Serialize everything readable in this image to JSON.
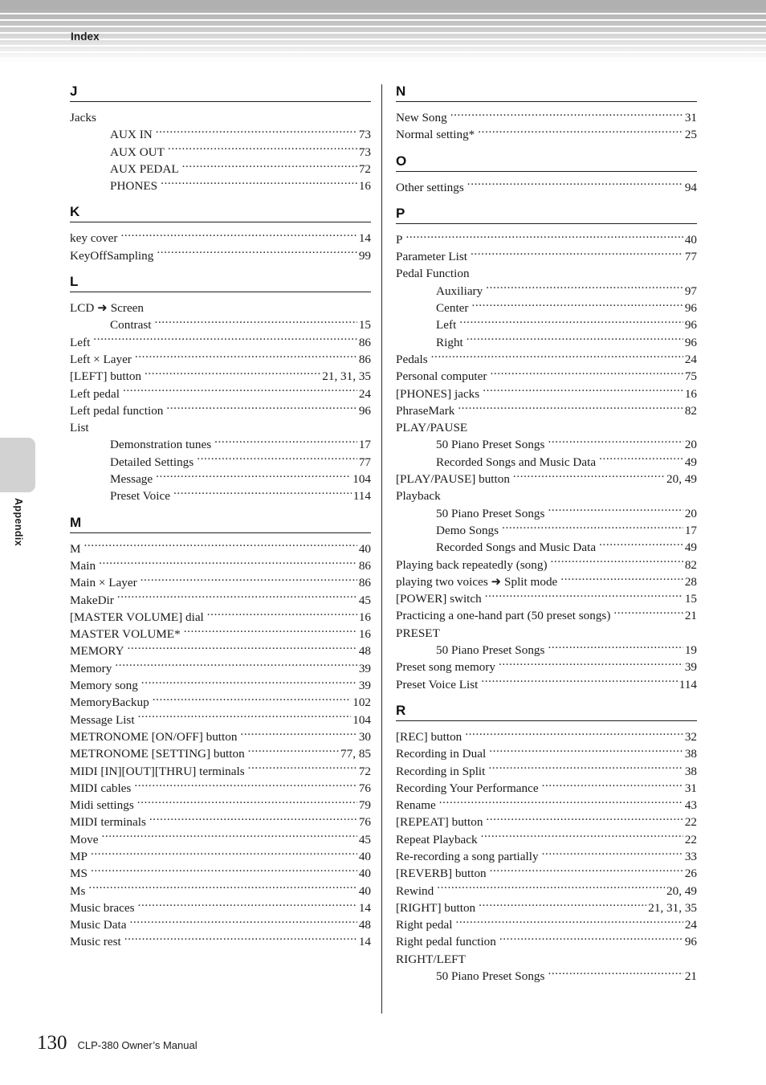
{
  "header": {
    "title": "Index"
  },
  "side_tab": {
    "label": "Appendix"
  },
  "footer": {
    "page_number": "130",
    "manual_title": "CLP-380 Owner’s Manual"
  },
  "columns": [
    {
      "id": "left",
      "sections": [
        {
          "letter": "J",
          "entries": [
            {
              "label": "Jacks",
              "page": "",
              "sub": false
            },
            {
              "label": "AUX IN",
              "page": "73",
              "sub": true
            },
            {
              "label": "AUX OUT",
              "page": "73",
              "sub": true
            },
            {
              "label": "AUX PEDAL",
              "page": "72",
              "sub": true
            },
            {
              "label": "PHONES",
              "page": "16",
              "sub": true
            }
          ]
        },
        {
          "letter": "K",
          "entries": [
            {
              "label": "key cover",
              "page": "14",
              "sub": false
            },
            {
              "label": "KeyOffSampling",
              "page": "99",
              "sub": false
            }
          ]
        },
        {
          "letter": "L",
          "entries": [
            {
              "label": "LCD ➜ Screen",
              "page": "",
              "sub": false
            },
            {
              "label": "Contrast",
              "page": "15",
              "sub": true
            },
            {
              "label": "Left",
              "page": "86",
              "sub": false
            },
            {
              "label": "Left × Layer",
              "page": "86",
              "sub": false
            },
            {
              "label": "[LEFT] button",
              "page": "21, 31, 35",
              "sub": false
            },
            {
              "label": "Left pedal",
              "page": "24",
              "sub": false
            },
            {
              "label": "Left pedal function",
              "page": "96",
              "sub": false
            },
            {
              "label": "List",
              "page": "",
              "sub": false
            },
            {
              "label": "Demonstration tunes",
              "page": "17",
              "sub": true
            },
            {
              "label": "Detailed Settings",
              "page": "77",
              "sub": true
            },
            {
              "label": "Message",
              "page": "104",
              "sub": true
            },
            {
              "label": "Preset Voice",
              "page": "114",
              "sub": true
            }
          ]
        },
        {
          "letter": "M",
          "entries": [
            {
              "label": "M",
              "page": "40",
              "sub": false
            },
            {
              "label": "Main",
              "page": "86",
              "sub": false
            },
            {
              "label": "Main × Layer",
              "page": "86",
              "sub": false
            },
            {
              "label": "MakeDir",
              "page": "45",
              "sub": false
            },
            {
              "label": "[MASTER VOLUME] dial",
              "page": "16",
              "sub": false
            },
            {
              "label": "MASTER VOLUME*",
              "page": "16",
              "sub": false
            },
            {
              "label": "MEMORY",
              "page": "48",
              "sub": false
            },
            {
              "label": "Memory",
              "page": "39",
              "sub": false
            },
            {
              "label": "Memory song",
              "page": "39",
              "sub": false
            },
            {
              "label": "MemoryBackup",
              "page": "102",
              "sub": false
            },
            {
              "label": "Message List",
              "page": "104",
              "sub": false
            },
            {
              "label": "METRONOME [ON/OFF] button",
              "page": "30",
              "sub": false
            },
            {
              "label": "METRONOME [SETTING] button",
              "page": "77, 85",
              "sub": false
            },
            {
              "label": "MIDI [IN][OUT][THRU] terminals",
              "page": "72",
              "sub": false
            },
            {
              "label": "MIDI cables",
              "page": "76",
              "sub": false
            },
            {
              "label": "Midi settings",
              "page": "79",
              "sub": false
            },
            {
              "label": "MIDI terminals",
              "page": "76",
              "sub": false
            },
            {
              "label": "Move",
              "page": "45",
              "sub": false
            },
            {
              "label": "MP",
              "page": "40",
              "sub": false
            },
            {
              "label": "MS",
              "page": "40",
              "sub": false
            },
            {
              "label": "Ms",
              "page": "40",
              "sub": false
            },
            {
              "label": "Music braces",
              "page": "14",
              "sub": false
            },
            {
              "label": "Music Data",
              "page": "48",
              "sub": false
            },
            {
              "label": "Music rest",
              "page": "14",
              "sub": false
            }
          ]
        }
      ]
    },
    {
      "id": "right",
      "sections": [
        {
          "letter": "N",
          "entries": [
            {
              "label": "New Song",
              "page": "31",
              "sub": false
            },
            {
              "label": "Normal setting*",
              "page": "25",
              "sub": false
            }
          ]
        },
        {
          "letter": "O",
          "entries": [
            {
              "label": "Other settings",
              "page": "94",
              "sub": false
            }
          ]
        },
        {
          "letter": "P",
          "entries": [
            {
              "label": "P",
              "page": "40",
              "sub": false
            },
            {
              "label": "Parameter List",
              "page": "77",
              "sub": false
            },
            {
              "label": "Pedal Function",
              "page": "",
              "sub": false
            },
            {
              "label": "Auxiliary",
              "page": "97",
              "sub": true
            },
            {
              "label": "Center",
              "page": "96",
              "sub": true
            },
            {
              "label": "Left",
              "page": "96",
              "sub": true
            },
            {
              "label": "Right",
              "page": "96",
              "sub": true
            },
            {
              "label": "Pedals",
              "page": "24",
              "sub": false
            },
            {
              "label": "Personal computer",
              "page": "75",
              "sub": false
            },
            {
              "label": "[PHONES] jacks",
              "page": "16",
              "sub": false
            },
            {
              "label": "PhraseMark",
              "page": "82",
              "sub": false
            },
            {
              "label": "PLAY/PAUSE",
              "page": "",
              "sub": false
            },
            {
              "label": "50 Piano Preset Songs",
              "page": "20",
              "sub": true
            },
            {
              "label": "Recorded Songs and Music Data",
              "page": "49",
              "sub": true
            },
            {
              "label": "[PLAY/PAUSE] button",
              "page": "20, 49",
              "sub": false
            },
            {
              "label": "Playback",
              "page": "",
              "sub": false
            },
            {
              "label": "50 Piano Preset Songs",
              "page": "20",
              "sub": true
            },
            {
              "label": "Demo Songs",
              "page": "17",
              "sub": true
            },
            {
              "label": "Recorded Songs and Music Data",
              "page": "49",
              "sub": true
            },
            {
              "label": "Playing back repeatedly (song)",
              "page": "82",
              "sub": false
            },
            {
              "label": "playing two voices ➜ Split mode",
              "page": "28",
              "sub": false
            },
            {
              "label": "[POWER] switch",
              "page": "15",
              "sub": false
            },
            {
              "label": "Practicing a one-hand part (50 preset songs)",
              "page": "21",
              "sub": false
            },
            {
              "label": "PRESET",
              "page": "",
              "sub": false
            },
            {
              "label": "50 Piano Preset Songs",
              "page": "19",
              "sub": true
            },
            {
              "label": "Preset song memory",
              "page": "39",
              "sub": false
            },
            {
              "label": "Preset Voice List",
              "page": "114",
              "sub": false
            }
          ]
        },
        {
          "letter": "R",
          "entries": [
            {
              "label": "[REC] button",
              "page": "32",
              "sub": false
            },
            {
              "label": "Recording in Dual",
              "page": "38",
              "sub": false
            },
            {
              "label": "Recording in Split",
              "page": "38",
              "sub": false
            },
            {
              "label": "Recording Your Performance",
              "page": "31",
              "sub": false
            },
            {
              "label": "Rename",
              "page": "43",
              "sub": false
            },
            {
              "label": "[REPEAT] button",
              "page": "22",
              "sub": false
            },
            {
              "label": "Repeat Playback",
              "page": "22",
              "sub": false
            },
            {
              "label": "Re-recording a song partially",
              "page": "33",
              "sub": false
            },
            {
              "label": "[REVERB] button",
              "page": "26",
              "sub": false
            },
            {
              "label": "Rewind",
              "page": "20, 49",
              "sub": false
            },
            {
              "label": "[RIGHT] button",
              "page": "21, 31, 35",
              "sub": false
            },
            {
              "label": "Right pedal",
              "page": "24",
              "sub": false
            },
            {
              "label": "Right pedal function",
              "page": "96",
              "sub": false
            },
            {
              "label": "RIGHT/LEFT",
              "page": "",
              "sub": false
            },
            {
              "label": "50 Piano Preset Songs",
              "page": "21",
              "sub": true
            }
          ]
        }
      ]
    }
  ]
}
